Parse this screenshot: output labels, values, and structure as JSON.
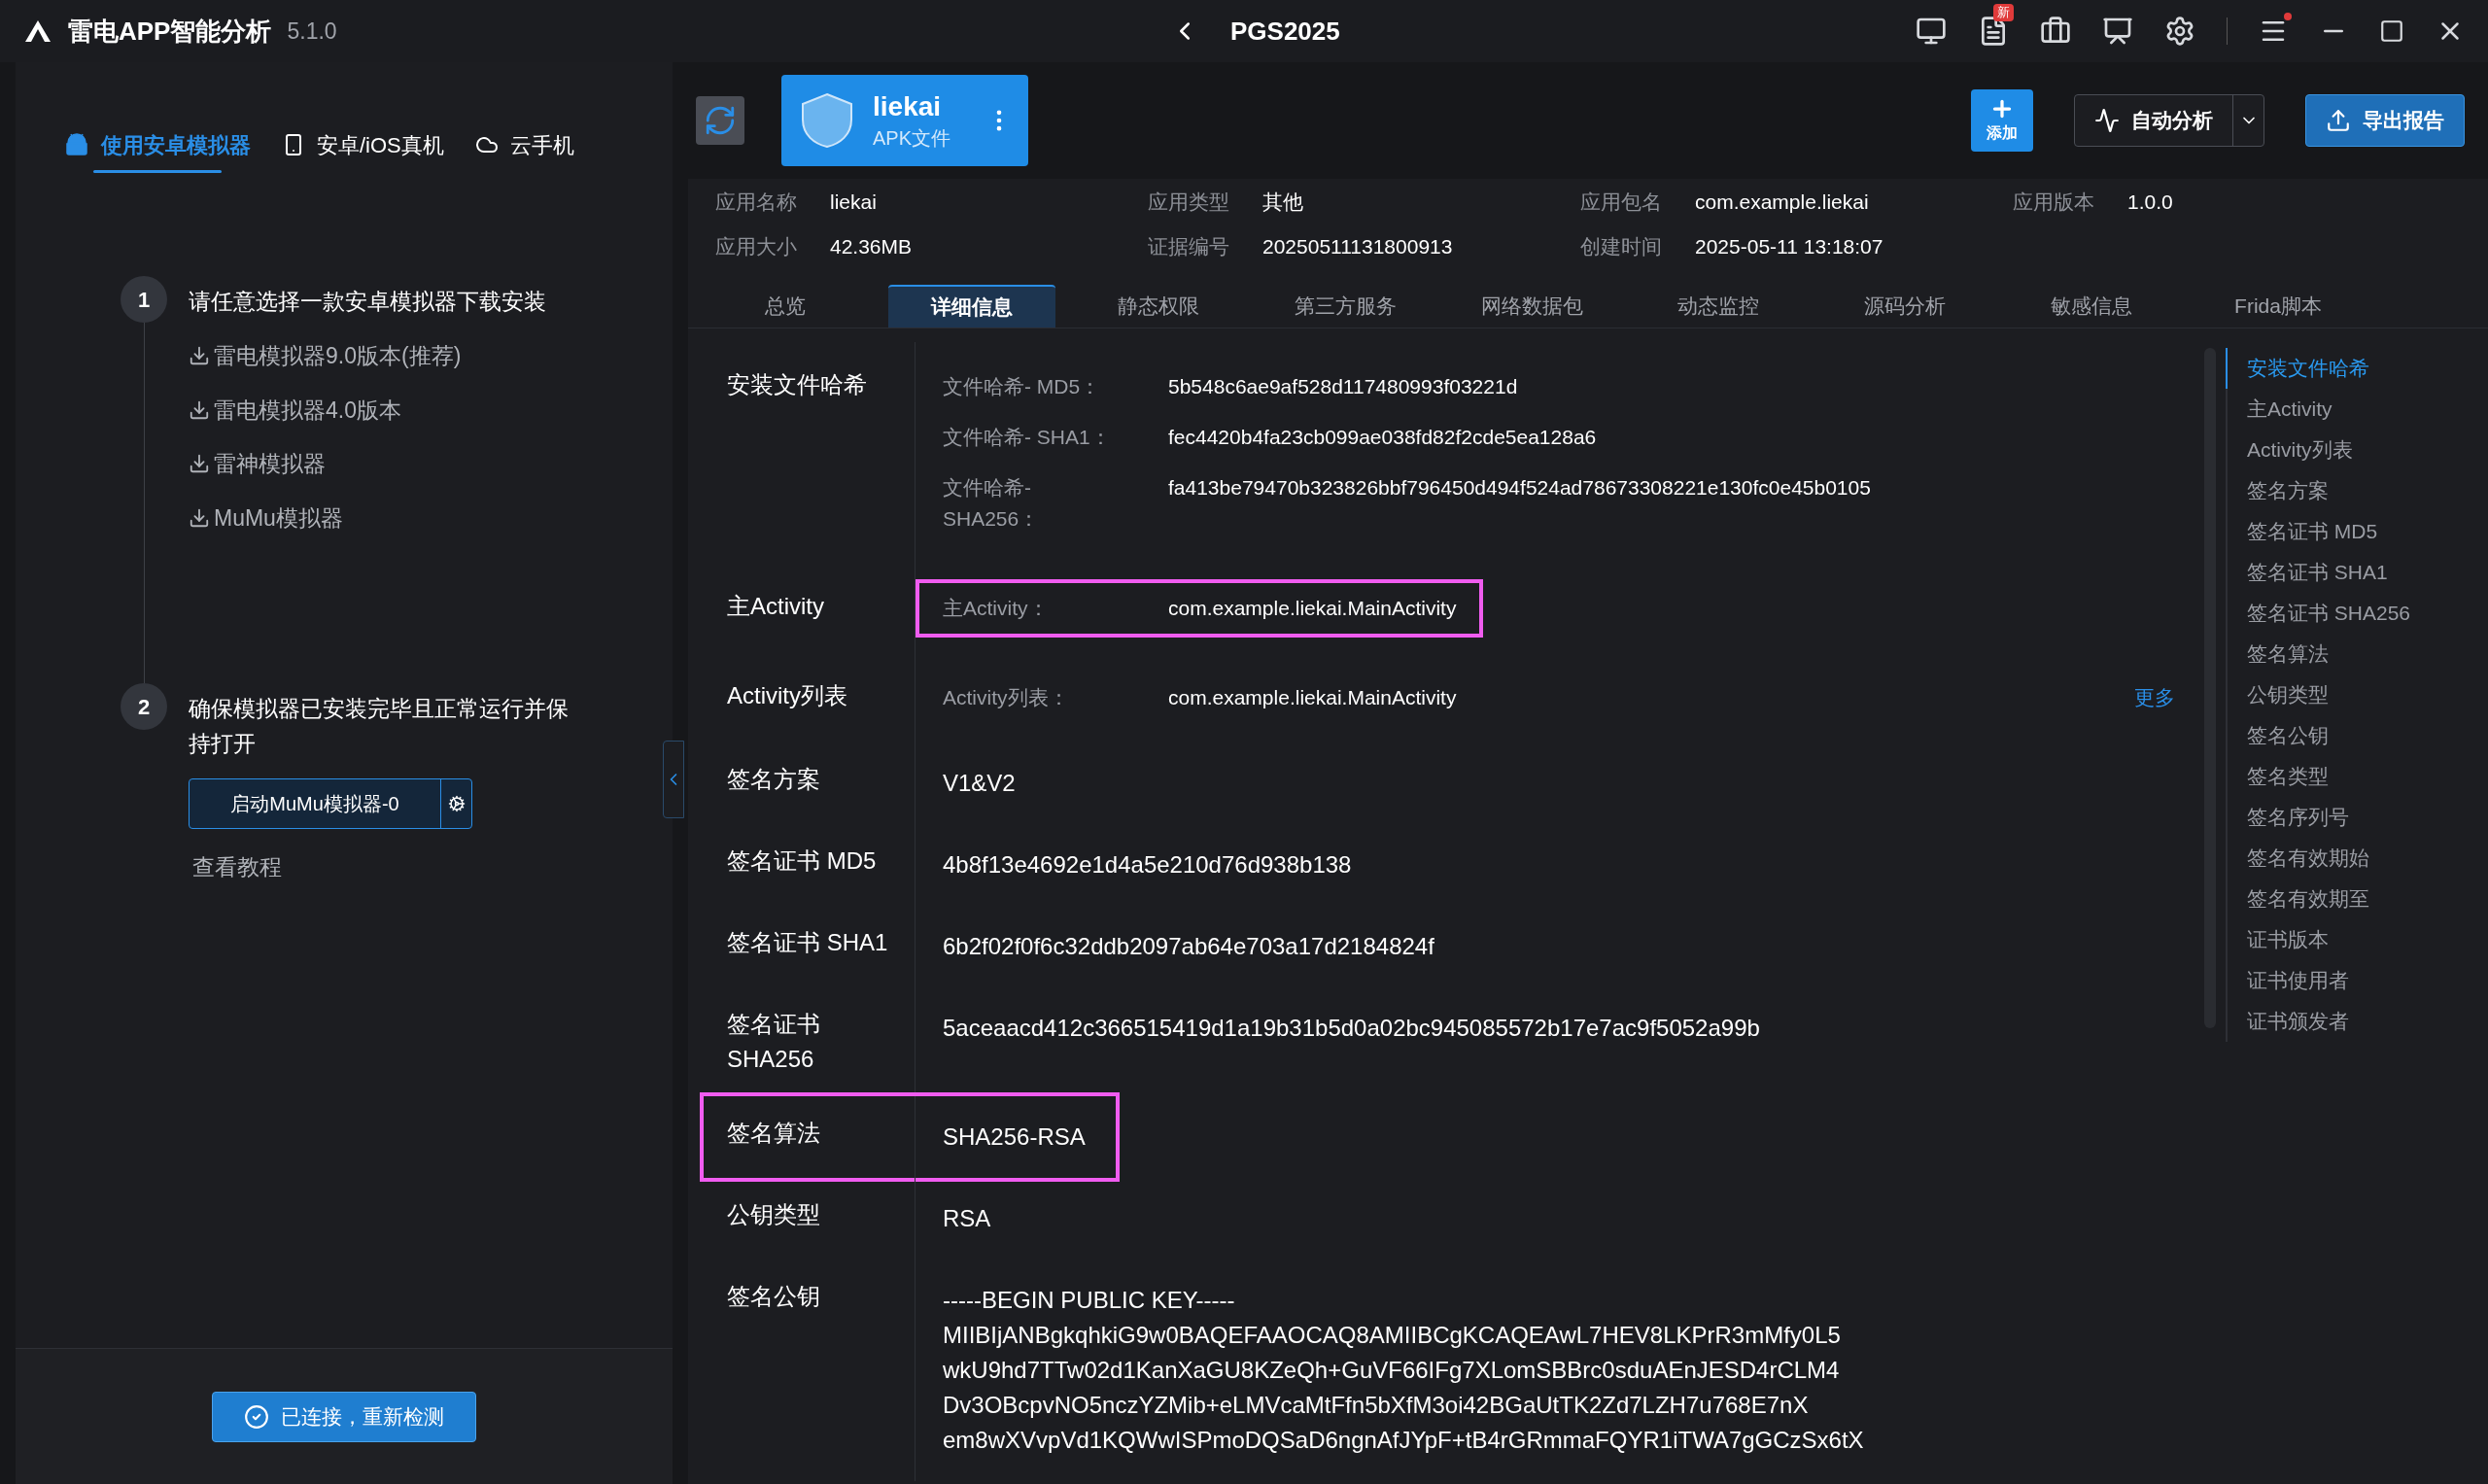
{
  "app": {
    "name": "雷电APP智能分析",
    "version": "5.1.0"
  },
  "title_bar": {
    "project": "PGS2025",
    "badge": "新"
  },
  "left_panel": {
    "tabs": [
      {
        "label": "使用安卓模拟器",
        "selected": true
      },
      {
        "label": "安卓/iOS真机",
        "selected": false
      },
      {
        "label": "云手机",
        "selected": false
      }
    ],
    "steps": [
      {
        "number": "1",
        "title": "请任意选择一款安卓模拟器下载安装",
        "downloads": [
          "雷电模拟器9.0版本(推荐)",
          "雷电模拟器4.0版本",
          "雷神模拟器",
          "MuMu模拟器"
        ]
      },
      {
        "number": "2",
        "title": "确保模拟器已安装完毕且正常运行并保持打开",
        "button": "启动MuMu模拟器-0",
        "link": "查看教程"
      }
    ],
    "status_button": "已连接，重新检测"
  },
  "header": {
    "app_card": {
      "name": "liekai",
      "type": "APK文件"
    },
    "actions": [
      {
        "label": "添加",
        "kind": "add"
      },
      {
        "label": "自动分析",
        "kind": "split"
      },
      {
        "label": "导出报告",
        "kind": "export"
      }
    ],
    "info": [
      {
        "label": "应用名称",
        "value": "liekai"
      },
      {
        "label": "应用类型",
        "value": "其他"
      },
      {
        "label": "应用包名",
        "value": "com.example.liekai"
      },
      {
        "label": "应用版本",
        "value": "1.0.0"
      },
      {
        "label": "应用大小",
        "value": "42.36MB"
      },
      {
        "label": "证据编号",
        "value": "20250511131800913"
      },
      {
        "label": "创建时间",
        "value": "2025-05-11 13:18:07"
      }
    ]
  },
  "tabs": [
    {
      "label": "总览",
      "selected": false
    },
    {
      "label": "详细信息",
      "selected": true
    },
    {
      "label": "静态权限",
      "selected": false
    },
    {
      "label": "第三方服务",
      "selected": false
    },
    {
      "label": "网络数据包",
      "selected": false
    },
    {
      "label": "动态监控",
      "selected": false
    },
    {
      "label": "源码分析",
      "selected": false
    },
    {
      "label": "敏感信息",
      "selected": false
    },
    {
      "label": "Frida脚本",
      "selected": false
    }
  ],
  "sections": [
    {
      "label": "安装文件哈希",
      "kind": "sub",
      "highlighted": false,
      "rows": [
        {
          "label": "文件哈希- MD5：",
          "value": "5b548c6ae9af528d117480993f03221d",
          "highlighted": false
        },
        {
          "label": "文件哈希- SHA1：",
          "value": "fec4420b4fa23cb099ae038fd82f2cde5ea128a6",
          "highlighted": false
        },
        {
          "label": "文件哈希- SHA256：",
          "value": "fa413be79470b323826bbf796450d494f524ad78673308221e130fc0e45b0105",
          "highlighted": false
        }
      ]
    },
    {
      "label": "主Activity",
      "kind": "sub",
      "highlighted": false,
      "rows": [
        {
          "label": "主Activity：",
          "value": "com.example.liekai.MainActivity",
          "highlighted": true
        }
      ]
    },
    {
      "label": "Activity列表",
      "kind": "sub",
      "highlighted": false,
      "more": "更多",
      "rows": [
        {
          "label": "Activity列表：",
          "value": "com.example.liekai.MainActivity",
          "highlighted": false
        }
      ]
    },
    {
      "label": "签名方案",
      "kind": "plain",
      "highlighted": false,
      "lines": [
        "V1&V2"
      ]
    },
    {
      "label": "签名证书 MD5",
      "kind": "plain",
      "highlighted": false,
      "lines": [
        "4b8f13e4692e1d4a5e210d76d938b138"
      ]
    },
    {
      "label": "签名证书 SHA1",
      "kind": "plain",
      "highlighted": false,
      "lines": [
        "6b2f02f0f6c32ddb2097ab64e703a17d2184824f"
      ]
    },
    {
      "label": "签名证书 SHA256",
      "kind": "plain",
      "highlighted": false,
      "lines": [
        "5aceaacd412c366515419d1a19b31b5d0a02bc945085572b17e7ac9f5052a99b"
      ]
    },
    {
      "label": "签名算法",
      "kind": "plain",
      "highlighted": true,
      "lines": [
        "SHA256-RSA"
      ]
    },
    {
      "label": "公钥类型",
      "kind": "plain",
      "highlighted": false,
      "lines": [
        "RSA"
      ]
    },
    {
      "label": "签名公钥",
      "kind": "plain",
      "highlighted": false,
      "lines": [
        "-----BEGIN PUBLIC KEY-----",
        "MIIBIjANBgkqhkiG9w0BAQEFAAOCAQ8AMIIBCgKCAQEAwL7HEV8LKPrR3mMfy0L5",
        "wkU9hd7TTw02d1KanXaGU8KZeQh+GuVF66IFg7XLomSBBrc0sduAEnJESD4rCLM4",
        "Dv3OBcpvNO5nczYZMib+eLMVcaMtFfn5bXfM3oi42BGaUtTK2Zd7LZH7u768E7nX",
        "em8wXVvpVd1KQWwISPmoDQSaD6ngnAfJYpF+tB4rGRmmaFQYR1iTWA7gGCzSx6tX"
      ]
    }
  ],
  "nav": [
    {
      "label": "安装文件哈希",
      "selected": true
    },
    {
      "label": "主Activity",
      "selected": false
    },
    {
      "label": "Activity列表",
      "selected": false
    },
    {
      "label": "签名方案",
      "selected": false
    },
    {
      "label": "签名证书 MD5",
      "selected": false
    },
    {
      "label": "签名证书 SHA1",
      "selected": false
    },
    {
      "label": "签名证书 SHA256",
      "selected": false
    },
    {
      "label": "签名算法",
      "selected": false
    },
    {
      "label": "公钥类型",
      "selected": false
    },
    {
      "label": "签名公钥",
      "selected": false
    },
    {
      "label": "签名类型",
      "selected": false
    },
    {
      "label": "签名序列号",
      "selected": false
    },
    {
      "label": "签名有效期始",
      "selected": false
    },
    {
      "label": "签名有效期至",
      "selected": false
    },
    {
      "label": "证书版本",
      "selected": false
    },
    {
      "label": "证书使用者",
      "selected": false
    },
    {
      "label": "证书颁发者",
      "selected": false
    }
  ]
}
